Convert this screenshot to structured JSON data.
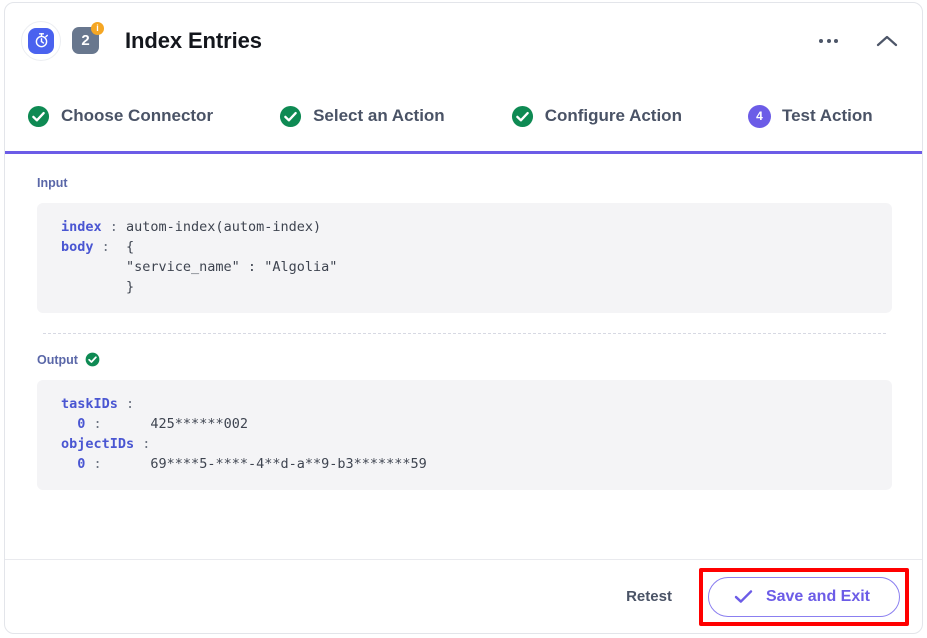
{
  "header": {
    "app_icon": "stopwatch-icon",
    "step_badge": "2",
    "badge_indicator": "i",
    "title": "Index Entries",
    "menu_icon": "ellipsis-icon",
    "collapse_icon": "chevron-up-icon"
  },
  "stepper": {
    "steps": [
      {
        "label": "Choose Connector",
        "state": "complete",
        "marker": "check"
      },
      {
        "label": "Select an Action",
        "state": "complete",
        "marker": "check"
      },
      {
        "label": "Configure Action",
        "state": "complete",
        "marker": "check"
      },
      {
        "label": "Test Action",
        "state": "active",
        "marker": "4"
      }
    ],
    "active_color": "#6c5ce7",
    "complete_color": "#0e8a53"
  },
  "input": {
    "label": "Input",
    "lines": [
      {
        "key": "index",
        "sep": " : ",
        "value": "autom-index(autom-index)"
      },
      {
        "key": "body",
        "sep": " :  ",
        "value": "{"
      },
      {
        "key": "",
        "sep": "",
        "value": "        \"service_name\" : \"Algolia\""
      },
      {
        "key": "",
        "sep": "",
        "value": "        }"
      }
    ]
  },
  "output": {
    "label": "Output",
    "status_icon": "check-circle-icon",
    "lines": [
      {
        "key": "taskIDs",
        "sep": " :",
        "value": ""
      },
      {
        "key": "  0",
        "sep": " :      ",
        "value": "425******002"
      },
      {
        "key": "objectIDs",
        "sep": " :",
        "value": ""
      },
      {
        "key": "  0",
        "sep": " :      ",
        "value": "69****5-****-4**d-a**9-b3*******59"
      }
    ]
  },
  "footer": {
    "retest_label": "Retest",
    "save_label": "Save and Exit",
    "save_icon": "check-icon",
    "highlight_color": "#ff0000"
  }
}
